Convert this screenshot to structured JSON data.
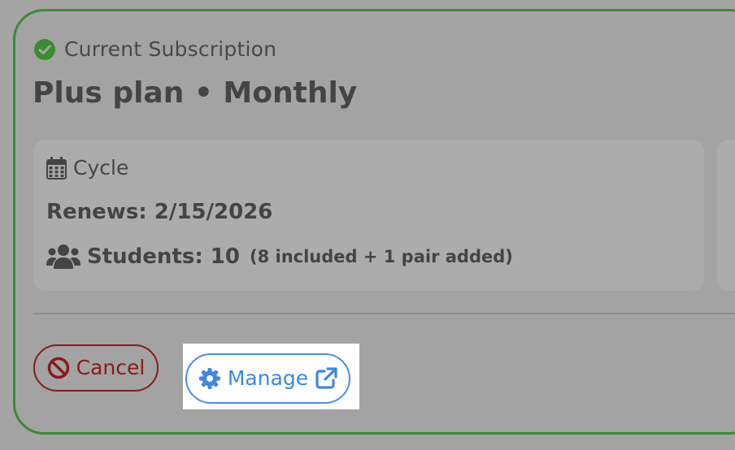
{
  "subscription": {
    "current_label": "Current Subscription",
    "plan_title": "Plus plan • Monthly",
    "status_color": "#3c8a34"
  },
  "cycle": {
    "label": "Cycle",
    "renews": "Renews: 2/15/2026",
    "students_label": "Students: 10",
    "students_detail": "(8 included + 1 pair added)"
  },
  "actions": {
    "cancel_label": "Cancel",
    "cancel_color": "#8b1a1a",
    "manage_label": "Manage",
    "manage_color": "#3f88e0"
  },
  "icons": {
    "status": "check-circle-icon",
    "cycle": "calendar-icon",
    "students": "users-icon",
    "cancel": "ban-icon",
    "manage": "cog-icon",
    "external": "external-link-icon"
  }
}
